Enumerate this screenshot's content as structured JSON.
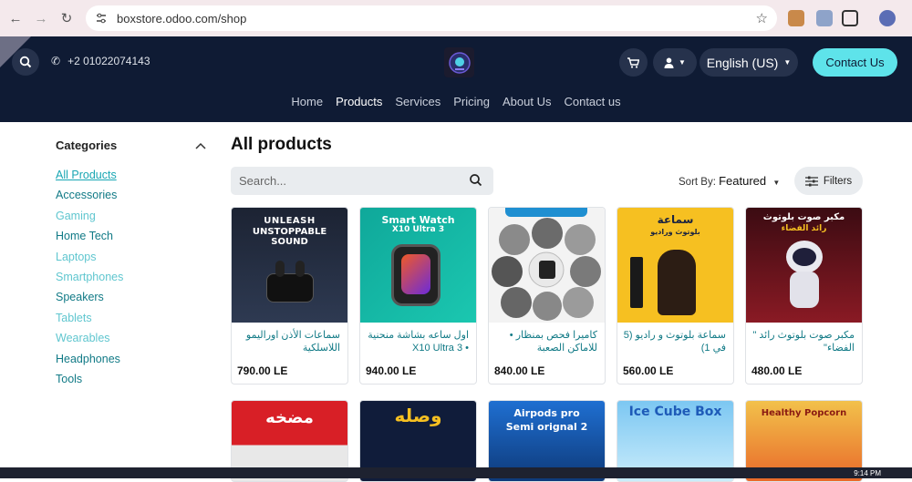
{
  "browser": {
    "url": "boxstore.odoo.com/shop"
  },
  "header": {
    "phone": "+2 01022074143",
    "language": "English (US)",
    "contact_label": "Contact Us",
    "nav": [
      "Home",
      "Products",
      "Services",
      "Pricing",
      "About Us",
      "Contact us"
    ],
    "active_nav": "Products"
  },
  "sidebar": {
    "title": "Categories",
    "items": [
      "All Products",
      "Accessories",
      "Gaming",
      "Home Tech",
      "Laptops",
      "Smartphones",
      "Speakers",
      "Tablets",
      "Wearables",
      "Headphones",
      "Tools"
    ]
  },
  "main": {
    "title": "All products",
    "search_placeholder": "Search...",
    "sort_label": "Sort By:",
    "sort_value": "Featured",
    "filters_label": "Filters"
  },
  "products": [
    {
      "name": "سماعات الأذن اوراليمو اللاسلكية",
      "price": "790.00 LE",
      "image_text": [
        "UNLEASH",
        "UNSTOPPABLE",
        "SOUND"
      ]
    },
    {
      "name": "اول ساعه بشاشة منحنية • X10 Ultra 3",
      "price": "940.00 LE",
      "image_text": [
        "Smart Watch",
        "X10 Ultra 3"
      ]
    },
    {
      "name": "كاميرا فحص بمنظار • للاماكن الصعبة",
      "price": "840.00 LE",
      "image_text": []
    },
    {
      "name": "سماعة بلوتوث و راديو (5 في 1)",
      "price": "560.00 LE",
      "image_text": [
        "سماعة",
        "بلوتوث وراديو"
      ]
    },
    {
      "name": "مكبر صوت بلوتوث رائد \" الفضاء\"",
      "price": "480.00 LE",
      "image_text": [
        "مكبر صوت بلوتوث",
        "رائد الفضاء"
      ]
    }
  ],
  "second_row": [
    {
      "image_text": "مضخه"
    },
    {
      "image_text": "وصله"
    },
    {
      "image_text": "Airpods pro Semi orignal 2"
    },
    {
      "image_text": "Ice Cube Box"
    },
    {
      "image_text": "Healthy Popcorn"
    }
  ],
  "taskbar": {
    "time": "9:14 PM"
  }
}
